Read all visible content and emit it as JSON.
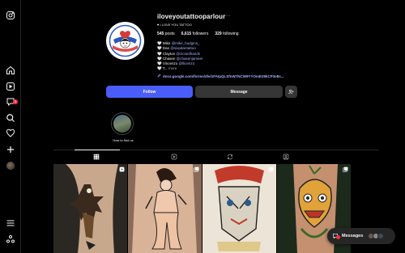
{
  "nav": {
    "items": [
      {
        "name": "instagram-logo-icon"
      },
      {
        "name": "home-icon"
      },
      {
        "name": "reels-icon"
      },
      {
        "name": "notifications-icon",
        "badge": "3"
      },
      {
        "name": "search-icon"
      },
      {
        "name": "heart-icon"
      },
      {
        "name": "create-icon"
      },
      {
        "name": "profile-avatar"
      },
      {
        "name": "menu-icon"
      },
      {
        "name": "also-from-meta-icon"
      }
    ]
  },
  "profile": {
    "username": "iloveyoutattooparlour",
    "more": "···",
    "name": "♥ I LOVE YOU TATTOO",
    "stats": {
      "posts_count": "545",
      "posts_label": "posts",
      "followers_count": "6,615",
      "followers_label": "followers",
      "following_count": "329",
      "following_label": "following"
    },
    "bio": [
      {
        "prefix": "🤍 Mike ",
        "handle": "@mike_hudgins_"
      },
      {
        "prefix": "🤍 Dan ",
        "handle": "@sixpdantattoo"
      },
      {
        "prefix": "🤍 Clayton ",
        "handle": "@clcsedhands"
      },
      {
        "prefix": "🤍 Chasen ",
        "handle": "@chasenjameel"
      },
      {
        "prefix": "🤍 Vincenzo ",
        "handle": "@llicenzo"
      }
    ],
    "bio_last": "🤍 T...",
    "bio_more": "more",
    "link": "docs.google.com/forms/d/e/1FAIpQLSfnW7NCW9YYOmE29kCP3e8s..."
  },
  "avatar_text": {
    "top": "OAKLAND",
    "bottom": "I LOVE YOU TATTOO"
  },
  "actions": {
    "follow": "Follow",
    "message": "Message"
  },
  "highlight": {
    "label": "How to find us"
  },
  "messages": {
    "label": "Messages"
  },
  "colors": {
    "follow_button": "#4a5df9",
    "link": "#a0b4ff",
    "background": "#000000",
    "badge": "#ff3040"
  }
}
